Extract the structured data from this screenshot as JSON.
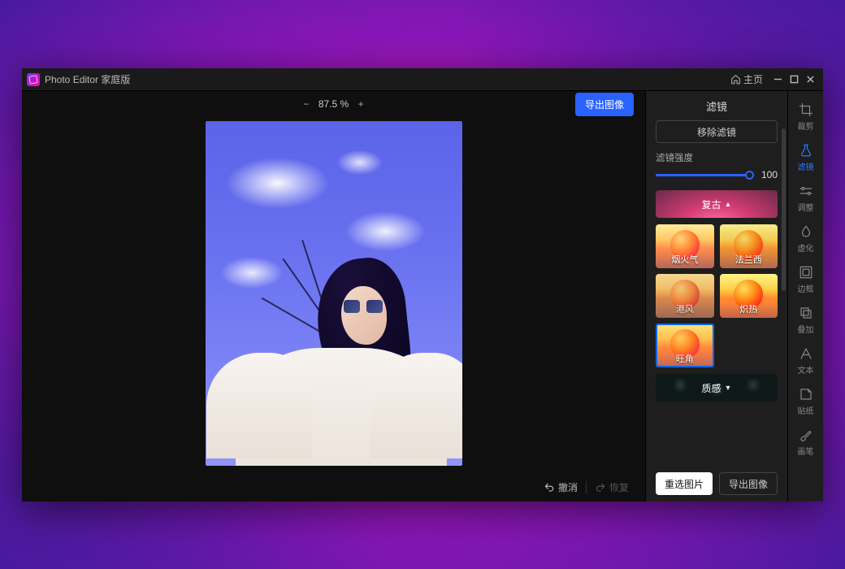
{
  "titlebar": {
    "app_title": "Photo Editor 家庭版",
    "home_label": "主页"
  },
  "canvas": {
    "zoom": "87.5 %",
    "export_label": "导出图像",
    "undo_label": "撤消",
    "redo_label": "恢复"
  },
  "panel": {
    "title": "滤镜",
    "remove_label": "移除滤镜",
    "intensity_label": "滤镜强度",
    "intensity_value": "100",
    "category_retro": "复古",
    "category_texture": "质感",
    "filters": {
      "f1": "烟火气",
      "f2": "法兰西",
      "f3": "港风",
      "f4": "炽热",
      "f5": "旺角"
    },
    "reselect_label": "重选图片",
    "export_label": "导出图像"
  },
  "tools": {
    "crop": "裁剪",
    "filter": "滤镜",
    "adjust": "调整",
    "blur": "虚化",
    "frame": "边框",
    "overlay": "叠加",
    "text": "文本",
    "sticker": "贴纸",
    "brush": "画笔"
  }
}
